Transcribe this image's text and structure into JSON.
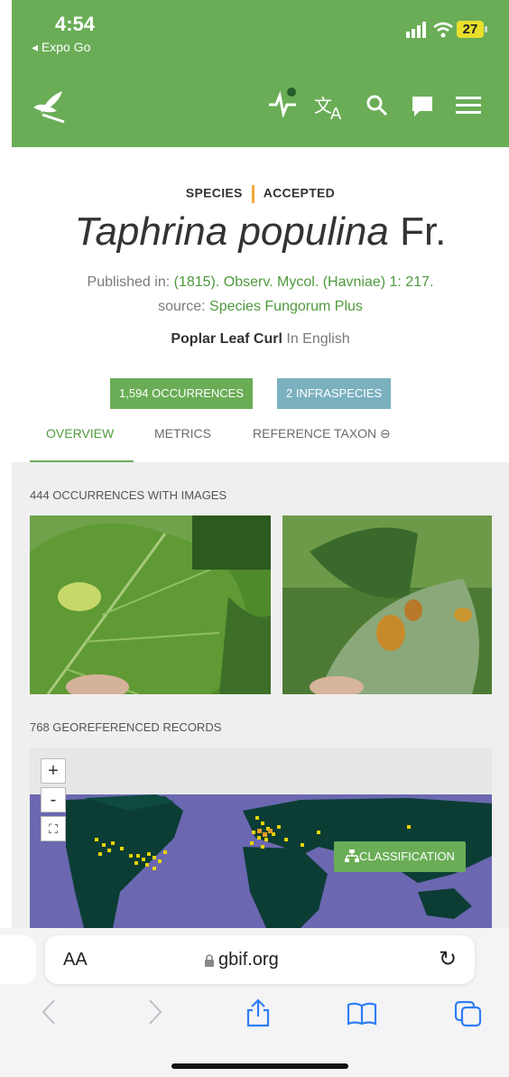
{
  "status_bar": {
    "time": "4:54",
    "back_app": "◂ Expo Go",
    "battery": "27"
  },
  "top_nav": {
    "icons": [
      "logo-leaf-icon",
      "activity-icon",
      "translate-icon",
      "search-icon",
      "chat-icon",
      "menu-icon"
    ]
  },
  "species": {
    "rank": "SPECIES",
    "status": "ACCEPTED",
    "name": "Taphrina populina",
    "author": "Fr.",
    "published_prefix": "Published in:",
    "published_ref": "(1815). Observ. Mycol. (Havniae) 1: 217.",
    "source_prefix": "source:",
    "source_name": "Species Fungorum Plus",
    "common_name": "Poplar Leaf Curl",
    "common_lang": "In English"
  },
  "counts": {
    "occurrences_count": "1,594",
    "occurrences_label": "OCCURRENCES",
    "infraspecies_count": "2",
    "infraspecies_label": "INFRASPECIES"
  },
  "tabs": [
    "OVERVIEW",
    "METRICS",
    "REFERENCE TAXON ⊖"
  ],
  "images_section": {
    "label": "444 OCCURRENCES WITH IMAGES"
  },
  "map_section": {
    "label": "768 GEOREFERENCED RECORDS",
    "zoom_in": "+",
    "zoom_out": "-",
    "fullscreen": "⛶",
    "classification": "CLASSIFICATION"
  },
  "browser": {
    "text_size": "AA",
    "url": "gbif.org",
    "reload": "↻"
  },
  "colors": {
    "accent_green": "#6aad56",
    "accent_teal": "#7bb0bf",
    "status_orange": "#f2a83b",
    "map_ocean": "#6b67b0",
    "map_land": "#0b3d35",
    "map_points": "#e8d400"
  }
}
